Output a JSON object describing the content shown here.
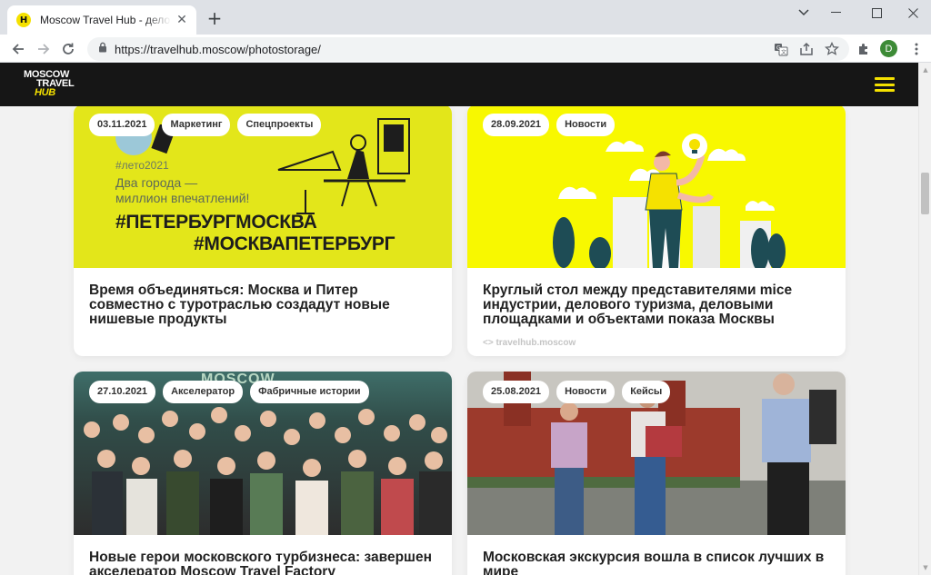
{
  "browser": {
    "tab_title": "Moscow Travel Hub - деловая платформа",
    "tab_favicon": "H",
    "tab_close": "✕",
    "new_tab": "+",
    "url": "https://travelhub.moscow/photostorage/",
    "profile_initial": "D",
    "icons": [
      "back-arrow-icon",
      "forward-arrow-icon",
      "reload-icon",
      "lock-icon",
      "translate-icon",
      "share-icon",
      "star-icon",
      "extensions-icon",
      "menu-dots-icon"
    ]
  },
  "site": {
    "logo": {
      "line1": "MOSCOW",
      "line2": "TRAVEL",
      "line3": "HUB"
    },
    "accent_color": "#f5e100",
    "header_bg": "#161616"
  },
  "cards": [
    {
      "date": "03.11.2021",
      "tags": [
        "Маркетинг",
        "Спецпроекты"
      ],
      "image": {
        "hashtag": "#лето2021",
        "subtitle_line1": "Два города —",
        "subtitle_line2": "миллион впечатлений!",
        "headline1": "#ПЕТЕРБУРГМОСКВА",
        "headline2": "#МОСКВАПЕТЕРБУРГ"
      },
      "title": "Время объединяться: Москва и Питер совместно с туротраслью создадут новые нишевые продукты"
    },
    {
      "date": "28.09.2021",
      "tags": [
        "Новости"
      ],
      "title": "Круглый стол между представителями mice индустрии, делового туризма, деловыми площадками и объектами показа Москвы",
      "source": "<> travelhub.moscow"
    },
    {
      "date": "27.10.2021",
      "tags": [
        "Акселератор",
        "Фабричные истории"
      ],
      "image": {
        "banner": "MOSCOW"
      },
      "title": "Новые герои московского турбизнеса: завершен акселератор Moscow Travel Factory"
    },
    {
      "date": "25.08.2021",
      "tags": [
        "Новости",
        "Кейсы"
      ],
      "title": "Московская экскурсия вошла в список лучших в мире"
    }
  ]
}
